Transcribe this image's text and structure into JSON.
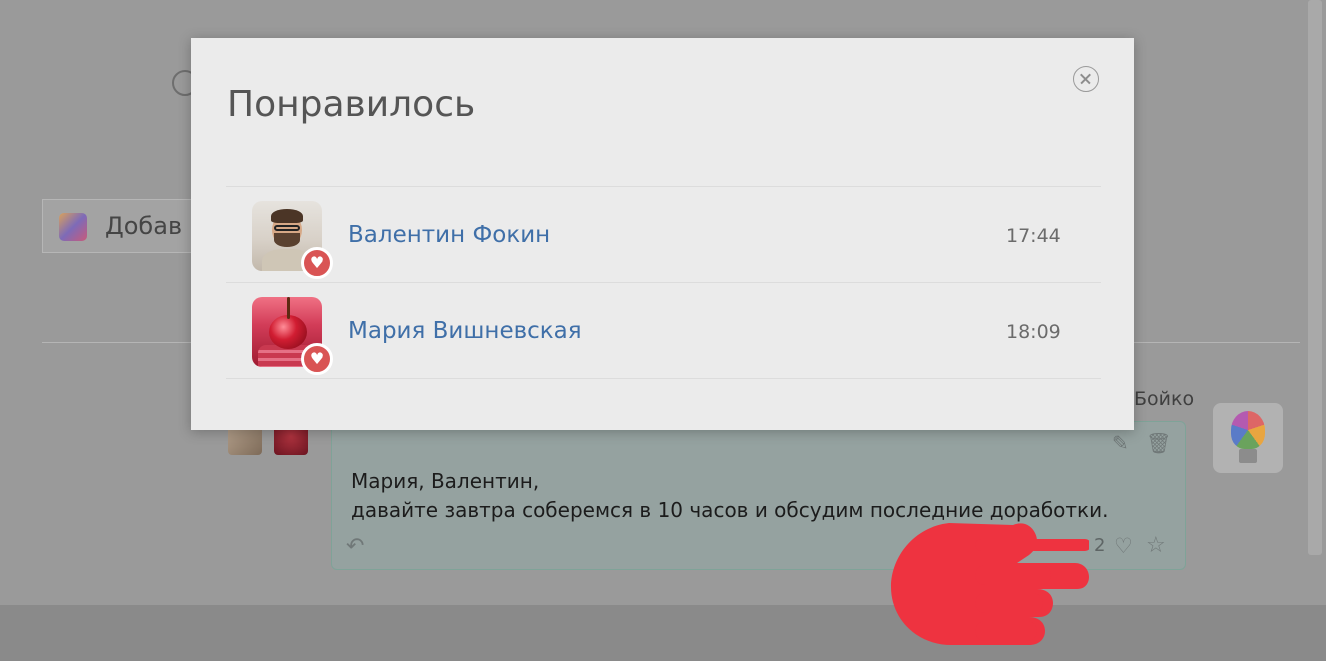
{
  "background": {
    "add_input_text": "Добав",
    "message_author": "Бойко",
    "message": {
      "lines": [
        "Мария, Валентин,",
        "давайте завтра соберемся в 10 часов и обсудим последние доработки."
      ],
      "likes_count": "2"
    }
  },
  "modal": {
    "title": "Понравилось",
    "likes": [
      {
        "name": "Валентин Фокин",
        "time": "17:44"
      },
      {
        "name": "Мария Вишневская",
        "time": "18:09"
      }
    ]
  },
  "icons": {
    "close": "close-circle-icon",
    "like_badge": "heart-icon",
    "edit": "edit-icon",
    "delete": "trash-icon",
    "reply": "reply-icon",
    "like": "heart-outline-icon",
    "favorite": "star-outline-icon",
    "cursor": "pointing-hand-icon"
  },
  "colors": {
    "link": "#3f6fa8",
    "badge": "#d95454",
    "modal_bg": "#ebebeb",
    "cursor": "#ee3340"
  }
}
